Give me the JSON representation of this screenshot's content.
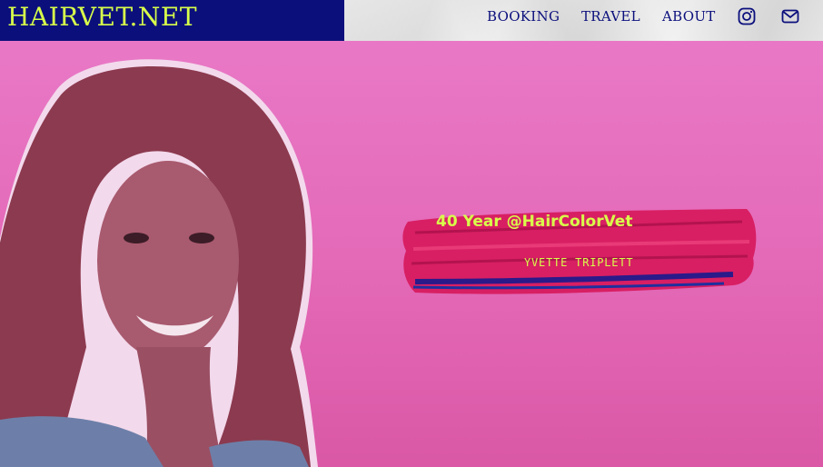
{
  "header": {
    "logo": "HAIRVET.NET",
    "nav": [
      {
        "label": "BOOKING"
      },
      {
        "label": "TRAVEL"
      },
      {
        "label": "ABOUT"
      }
    ],
    "icons": [
      "instagram-icon",
      "mail-icon"
    ]
  },
  "hero": {
    "title": "40 Year @HairColorVet",
    "subtitle": "YVETTE TRIPLETT"
  },
  "colors": {
    "brand_navy": "#0b0f7c",
    "accent_lime": "#d8ff4a",
    "background_pink": "#e46ab8",
    "brush_magenta": "#d81f63"
  }
}
